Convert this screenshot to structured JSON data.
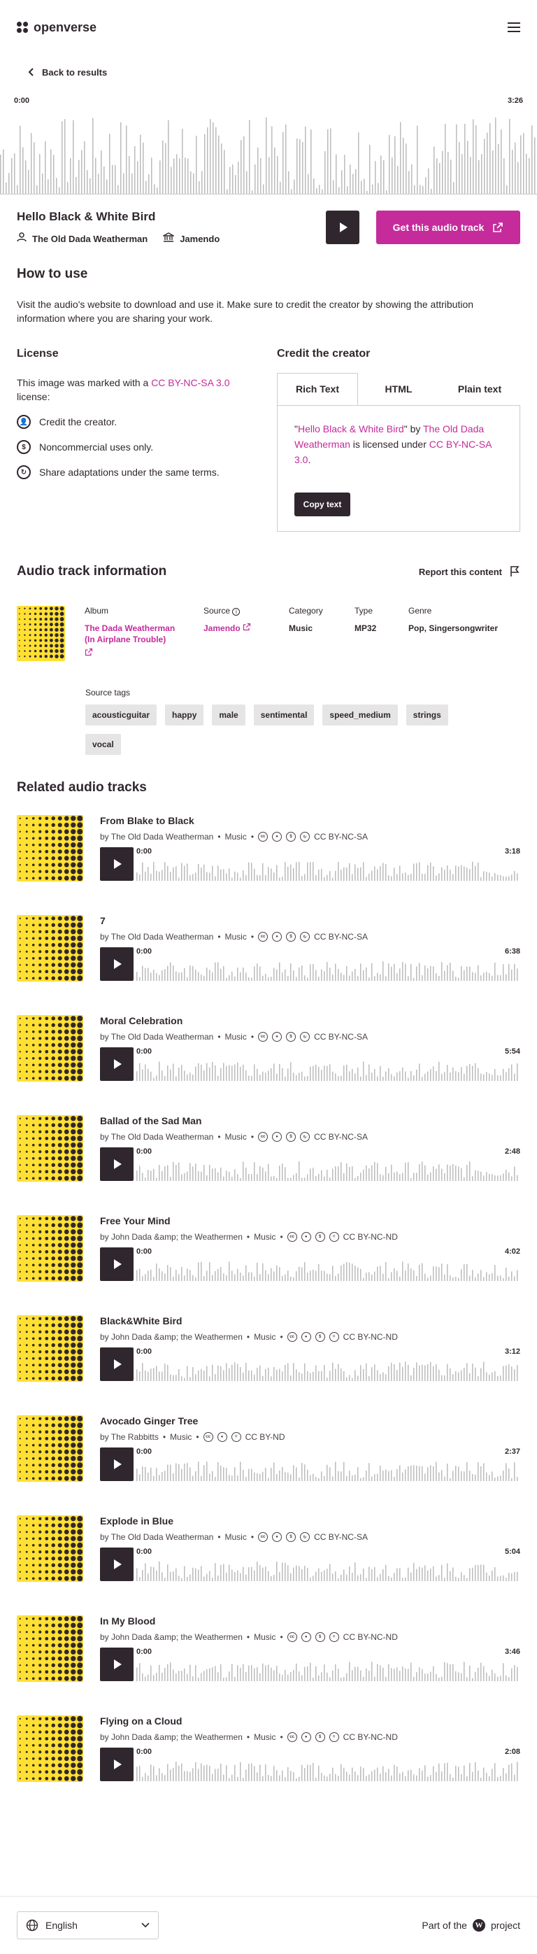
{
  "header": {
    "brand": "openverse"
  },
  "nav": {
    "back_label": "Back to results"
  },
  "player": {
    "current_time": "0:00",
    "duration": "3:26"
  },
  "track": {
    "title": "Hello Black & White Bird",
    "creator": "The Old Dada Weatherman",
    "provider": "Jamendo",
    "get_button": "Get this audio track"
  },
  "how_to_use": {
    "heading": "How to use",
    "text": "Visit the audio's website to download and use it. Make sure to credit the creator by showing the attribution information where you are sharing your work."
  },
  "license": {
    "heading": "License",
    "text_before": "This image was marked with a ",
    "license_name": "CC BY-NC-SA 3.0",
    "text_after": " license:",
    "terms": [
      "Credit the creator.",
      "Noncommercial uses only.",
      "Share adaptations under the same terms."
    ]
  },
  "credit": {
    "heading": "Credit the creator",
    "tabs": [
      "Rich Text",
      "HTML",
      "Plain text"
    ],
    "quote_open": "\"",
    "title_link": "Hello Black & White Bird",
    "by": "\" by ",
    "creator_link": "The Old Dada Weatherman",
    "licensed": " is licensed under ",
    "license_link": "CC BY-NC-SA 3.0",
    "period": ".",
    "copy_button": "Copy text"
  },
  "info": {
    "heading": "Audio track information",
    "report": "Report this content",
    "album_label": "Album",
    "album": "The Dada Weatherman (In Airplane Trouble)",
    "source_label": "Source",
    "source": "Jamendo",
    "category_label": "Category",
    "category": "Music",
    "type_label": "Type",
    "type": "MP32",
    "genre_label": "Genre",
    "genre": "Pop, Singersongwriter",
    "tags_label": "Source tags",
    "tags": [
      "acousticguitar",
      "happy",
      "male",
      "sentimental",
      "speed_medium",
      "strings",
      "vocal"
    ]
  },
  "related": {
    "heading": "Related audio tracks",
    "items": [
      {
        "title": "From Blake to Black",
        "by": "by The Old Dada Weatherman",
        "category": "Music",
        "license": "CC BY-NC-SA",
        "icons": [
          "cc",
          "by",
          "nc",
          "sa"
        ],
        "start": "0:00",
        "duration": "3:18"
      },
      {
        "title": "7",
        "by": "by The Old Dada Weatherman",
        "category": "Music",
        "license": "CC BY-NC-SA",
        "icons": [
          "cc",
          "by",
          "nc",
          "sa"
        ],
        "start": "0:00",
        "duration": "6:38"
      },
      {
        "title": "Moral Celebration",
        "by": "by The Old Dada Weatherman",
        "category": "Music",
        "license": "CC BY-NC-SA",
        "icons": [
          "cc",
          "by",
          "nc",
          "sa"
        ],
        "start": "0:00",
        "duration": "5:54"
      },
      {
        "title": "Ballad of the Sad Man",
        "by": "by The Old Dada Weatherman",
        "category": "Music",
        "license": "CC BY-NC-SA",
        "icons": [
          "cc",
          "by",
          "nc",
          "sa"
        ],
        "start": "0:00",
        "duration": "2:48"
      },
      {
        "title": "Free Your Mind",
        "by": "by John Dada &amp; the Weathermen",
        "category": "Music",
        "license": "CC BY-NC-ND",
        "icons": [
          "cc",
          "by",
          "nc",
          "nd"
        ],
        "start": "0:00",
        "duration": "4:02"
      },
      {
        "title": "Black&White Bird",
        "by": "by John Dada &amp; the Weathermen",
        "category": "Music",
        "license": "CC BY-NC-ND",
        "icons": [
          "cc",
          "by",
          "nc",
          "nd"
        ],
        "start": "0:00",
        "duration": "3:12"
      },
      {
        "title": "Avocado Ginger Tree",
        "by": "by The Rabbitts",
        "category": "Music",
        "license": "CC BY-ND",
        "icons": [
          "cc",
          "by",
          "nd"
        ],
        "start": "0:00",
        "duration": "2:37"
      },
      {
        "title": "Explode in Blue",
        "by": "by The Old Dada Weatherman",
        "category": "Music",
        "license": "CC BY-NC-SA",
        "icons": [
          "cc",
          "by",
          "nc",
          "sa"
        ],
        "start": "0:00",
        "duration": "5:04"
      },
      {
        "title": "In My Blood",
        "by": "by John Dada &amp; the Weathermen",
        "category": "Music",
        "license": "CC BY-NC-ND",
        "icons": [
          "cc",
          "by",
          "nc",
          "nd"
        ],
        "start": "0:00",
        "duration": "3:46"
      },
      {
        "title": "Flying on a Cloud",
        "by": "by John Dada &amp; the Weathermen",
        "category": "Music",
        "license": "CC BY-NC-ND",
        "icons": [
          "cc",
          "by",
          "nc",
          "nd"
        ],
        "start": "0:00",
        "duration": "2:08"
      }
    ]
  },
  "footer": {
    "language": "English",
    "part_of": "Part of the",
    "project": "project"
  },
  "colors": {
    "accent": "#c52b9b",
    "dark": "#30272e",
    "thumb_yellow": "#ffe033"
  }
}
